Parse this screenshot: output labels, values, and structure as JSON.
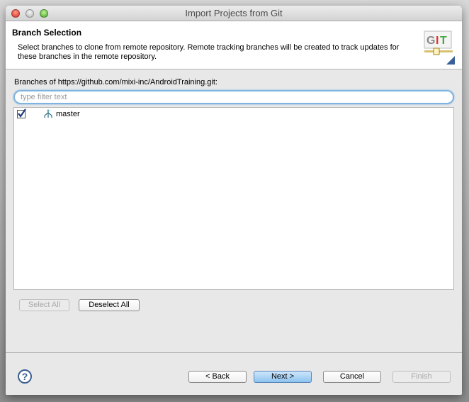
{
  "window": {
    "title": "Import Projects from Git"
  },
  "header": {
    "title": "Branch Selection",
    "description": "Select branches to clone from remote repository. Remote tracking branches will be created to track updates for these branches in the remote repository.",
    "icon": "git-icon"
  },
  "branches_label": "Branches of https://github.com/mixi-inc/AndroidTraining.git:",
  "filter": {
    "placeholder": "type filter text",
    "value": ""
  },
  "branches": [
    {
      "name": "master",
      "checked": true,
      "icon": "branch-icon"
    }
  ],
  "buttons": {
    "select_all": "Select All",
    "deselect_all": "Deselect All",
    "back": "< Back",
    "next": "Next >",
    "cancel": "Cancel",
    "finish": "Finish"
  },
  "help": "?"
}
